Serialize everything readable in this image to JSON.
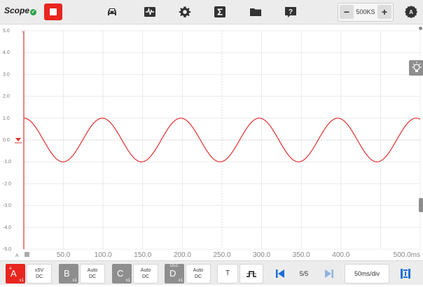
{
  "toolbar": {
    "logo": "Scope",
    "sample_rate": "500KS",
    "minus": "−",
    "plus": "+"
  },
  "plot": {
    "y_ticks": [
      "5.0",
      "4.0",
      "3.0",
      "2.0",
      "1.0",
      "0.0",
      "-1.0",
      "-2.0",
      "-3.0",
      "-4.0",
      "-5.0"
    ],
    "y_unit": "V",
    "x_ticks": [
      "50.0",
      "100.0",
      "150.0",
      "200.0",
      "250.0",
      "300.0",
      "350.0",
      "400.0",
      "500.0ms"
    ],
    "channel_marker": "A",
    "trace_color": "#e03030"
  },
  "channels": [
    {
      "letter": "A",
      "mult": "x1",
      "set_top": "±5V",
      "set_bottom": "DC",
      "color": "#e8251f"
    },
    {
      "letter": "B",
      "mult": "x1",
      "set_top": "Auto",
      "set_bottom": "DC",
      "color": "#8e8e8e"
    },
    {
      "letter": "C",
      "mult": "x1",
      "set_top": "Auto",
      "set_bottom": "DC",
      "color": "#8e8e8e"
    },
    {
      "letter": "D",
      "mult": "x1",
      "top_label": "DLC",
      "set_top": "Auto",
      "set_bottom": "DC",
      "color": "#8e8e8e"
    }
  ],
  "bottom": {
    "trigger_label": "T",
    "page": "5/5",
    "timebase": "50ms/div"
  },
  "accent": "#1a6fd6"
}
